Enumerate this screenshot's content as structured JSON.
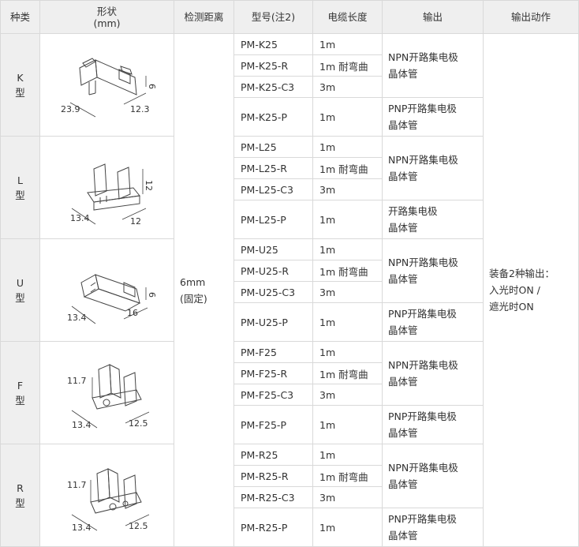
{
  "headers": {
    "type": "种类",
    "shape": "形状",
    "shape_unit": "(mm)",
    "distance": "检测距离",
    "model": "型号(注2)",
    "cable": "电缆长度",
    "output": "输出",
    "action": "输出动作"
  },
  "distance": {
    "value": "6mm",
    "note": "(固定)"
  },
  "action": {
    "line1": "装备2种输出：",
    "line2": "入光时ON /",
    "line3": "遮光时ON"
  },
  "groups": [
    {
      "type_letter": "K",
      "type_char": "型",
      "dims": [
        "23.9",
        "12.3",
        "6"
      ],
      "rows": [
        {
          "model": "PM-K25",
          "cable": "1m"
        },
        {
          "model": "PM-K25-R",
          "cable": "1m 耐弯曲"
        },
        {
          "model": "PM-K25-C3",
          "cable": "3m"
        },
        {
          "model": "PM-K25-P",
          "cable": "1m"
        }
      ],
      "out1": [
        "NPN开路集电极",
        "晶体管"
      ],
      "out2": [
        "PNP开路集电极",
        "晶体管"
      ]
    },
    {
      "type_letter": "L",
      "type_char": "型",
      "dims": [
        "13.4",
        "12",
        "12"
      ],
      "rows": [
        {
          "model": "PM-L25",
          "cable": "1m"
        },
        {
          "model": "PM-L25-R",
          "cable": "1m 耐弯曲"
        },
        {
          "model": "PM-L25-C3",
          "cable": "3m"
        },
        {
          "model": "PM-L25-P",
          "cable": "1m"
        }
      ],
      "out1": [
        "NPN开路集电极",
        "晶体管"
      ],
      "out2": [
        "开路集电极",
        "晶体管"
      ]
    },
    {
      "type_letter": "U",
      "type_char": "型",
      "dims": [
        "13.4",
        "16",
        "6"
      ],
      "rows": [
        {
          "model": "PM-U25",
          "cable": "1m"
        },
        {
          "model": "PM-U25-R",
          "cable": "1m 耐弯曲"
        },
        {
          "model": "PM-U25-C3",
          "cable": "3m"
        },
        {
          "model": "PM-U25-P",
          "cable": "1m"
        }
      ],
      "out1": [
        "NPN开路集电极",
        "晶体管"
      ],
      "out2": [
        "PNP开路集电极",
        "晶体管"
      ]
    },
    {
      "type_letter": "F",
      "type_char": "型",
      "dims": [
        "11.7",
        "13.4",
        "12.5"
      ],
      "rows": [
        {
          "model": "PM-F25",
          "cable": "1m"
        },
        {
          "model": "PM-F25-R",
          "cable": "1m 耐弯曲"
        },
        {
          "model": "PM-F25-C3",
          "cable": "3m"
        },
        {
          "model": "PM-F25-P",
          "cable": "1m"
        }
      ],
      "out1": [
        "NPN开路集电极",
        "晶体管"
      ],
      "out2": [
        "PNP开路集电极",
        "晶体管"
      ]
    },
    {
      "type_letter": "R",
      "type_char": "型",
      "dims": [
        "11.7",
        "13.4",
        "12.5"
      ],
      "rows": [
        {
          "model": "PM-R25",
          "cable": "1m"
        },
        {
          "model": "PM-R25-R",
          "cable": "1m 耐弯曲"
        },
        {
          "model": "PM-R25-C3",
          "cable": "3m"
        },
        {
          "model": "PM-R25-P",
          "cable": "1m"
        }
      ],
      "out1": [
        "NPN开路集电极",
        "晶体管"
      ],
      "out2": [
        "PNP开路集电极",
        "晶体管"
      ]
    }
  ]
}
